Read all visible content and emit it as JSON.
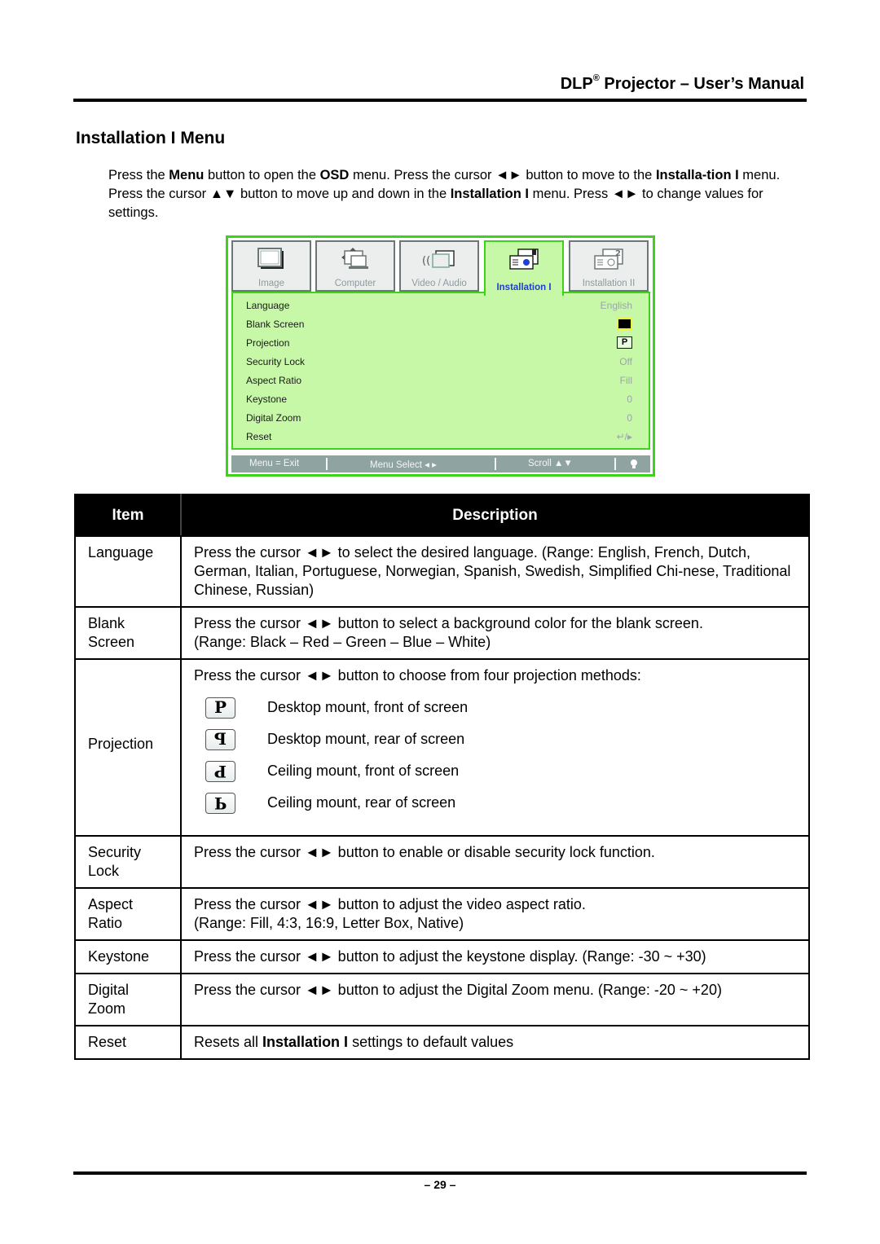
{
  "header": {
    "brand": "DLP",
    "registered": "®",
    "title_rest": " Projector – User’s Manual"
  },
  "section_title": "Installation I Menu",
  "intro": {
    "p1": "Press the ",
    "b1": "Menu",
    "p2": " button to open the ",
    "b2": "OSD",
    "p3": " menu. Press the cursor ◄► button to move to the ",
    "b3": "Installa-tion I",
    "p4": " menu. Press the cursor ▲▼ button to move up and down in the ",
    "b4": "Installation I",
    "p5": " menu. Press ◄► to change values for settings."
  },
  "osd": {
    "tabs": [
      {
        "label": "Image",
        "icon": "image-icon",
        "active": false
      },
      {
        "label": "Computer",
        "icon": "computer-icon",
        "active": false
      },
      {
        "label": "Video / Audio",
        "icon": "video-audio-icon",
        "active": false
      },
      {
        "label": "Installation I",
        "icon": "installation-1-icon",
        "active": true
      },
      {
        "label": "Installation II",
        "icon": "installation-2-icon",
        "active": false
      }
    ],
    "rows": [
      {
        "label": "Language",
        "value": "English"
      },
      {
        "label": "Blank Screen",
        "value": "black-swatch"
      },
      {
        "label": "Projection",
        "value": "P"
      },
      {
        "label": "Security Lock",
        "value": "Off"
      },
      {
        "label": "Aspect Ratio",
        "value": "Fill"
      },
      {
        "label": "Keystone",
        "value": "0"
      },
      {
        "label": "Digital Zoom",
        "value": "0"
      },
      {
        "label": "Reset",
        "value": "↵/▸"
      }
    ],
    "statusbar": {
      "exit": "Menu = Exit",
      "select": "Menu Select ◂ ▸",
      "scroll": "Scroll ▲▼",
      "lamp_icon": "lamp-icon"
    },
    "colors": {
      "frame": "#3fd21a",
      "panel": "#c7f8a8",
      "active_label": "#1f3fd0",
      "bar": "#8fa3a0"
    }
  },
  "table": {
    "headers": {
      "item": "Item",
      "description": "Description"
    },
    "rows": [
      {
        "item": "Language",
        "desc": "Press the cursor ◄► to select the desired language. (Range: English, French, Dutch, German, Italian, Portuguese, Norwegian, Spanish, Swedish, Simplified Chi-nese, Traditional Chinese, Russian)"
      },
      {
        "item": "Blank Screen",
        "desc": "Press the cursor ◄► button to select a background color for the blank screen.",
        "desc2": "(Range: Black – Red – Green – Blue – White)"
      },
      {
        "item": "Projection",
        "desc": "Press the cursor ◄► button to choose from four projection methods:",
        "options": [
          {
            "glyph": "P",
            "text": "Desktop mount, front of screen"
          },
          {
            "glyph": "P",
            "text": "Desktop mount, rear of screen"
          },
          {
            "glyph": "P",
            "text": "Ceiling mount, front of screen"
          },
          {
            "glyph": "P",
            "text": "Ceiling mount, rear of screen"
          }
        ]
      },
      {
        "item": "Security Lock",
        "desc": "Press the cursor ◄► button to enable or disable security lock function."
      },
      {
        "item": "Aspect Ratio",
        "desc": "Press the cursor ◄► button to adjust the video aspect ratio.",
        "desc2": "(Range: Fill, 4:3, 16:9, Letter Box, Native)"
      },
      {
        "item": "Keystone",
        "desc": "Press the cursor ◄► button to adjust the keystone display. (Range: -30 ~ +30)"
      },
      {
        "item": "Digital Zoom",
        "desc": "Press the cursor ◄► button to adjust the Digital Zoom menu. (Range: -20 ~ +20)"
      },
      {
        "item": "Reset",
        "desc_pre": "Resets all ",
        "desc_bold": "Installation I",
        "desc_post": " settings to default values"
      }
    ]
  },
  "footer": {
    "page": "– 29 –"
  }
}
